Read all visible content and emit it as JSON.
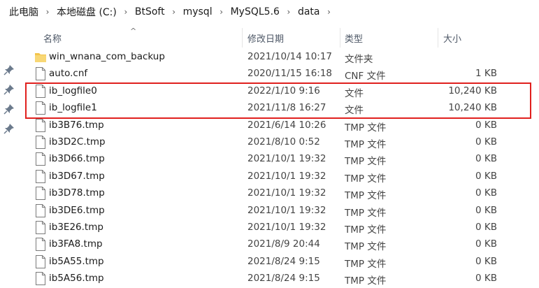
{
  "breadcrumb": {
    "items": [
      "此电脑",
      "本地磁盘 (C:)",
      "BtSoft",
      "mysql",
      "MySQL5.6",
      "data"
    ]
  },
  "columns": {
    "name": "名称",
    "modified": "修改日期",
    "type": "类型",
    "size": "大小"
  },
  "files": [
    {
      "name": "win_wnana_com_backup",
      "modified": "2021/10/14 10:17",
      "type": "文件夹",
      "size": "",
      "icon": "folder-icon"
    },
    {
      "name": "auto.cnf",
      "modified": "2020/11/15 16:18",
      "type": "CNF 文件",
      "size": "1 KB",
      "icon": "file-icon"
    },
    {
      "name": "ib_logfile0",
      "modified": "2022/1/10 9:16",
      "type": "文件",
      "size": "10,240 KB",
      "icon": "file-icon"
    },
    {
      "name": "ib_logfile1",
      "modified": "2021/11/8 16:27",
      "type": "文件",
      "size": "10,240 KB",
      "icon": "file-icon"
    },
    {
      "name": "ib3B76.tmp",
      "modified": "2021/6/14 10:26",
      "type": "TMP 文件",
      "size": "0 KB",
      "icon": "file-icon"
    },
    {
      "name": "ib3D2C.tmp",
      "modified": "2021/8/10 0:52",
      "type": "TMP 文件",
      "size": "0 KB",
      "icon": "file-icon"
    },
    {
      "name": "ib3D66.tmp",
      "modified": "2021/10/1 19:32",
      "type": "TMP 文件",
      "size": "0 KB",
      "icon": "file-icon"
    },
    {
      "name": "ib3D67.tmp",
      "modified": "2021/10/1 19:32",
      "type": "TMP 文件",
      "size": "0 KB",
      "icon": "file-icon"
    },
    {
      "name": "ib3D78.tmp",
      "modified": "2021/10/1 19:32",
      "type": "TMP 文件",
      "size": "0 KB",
      "icon": "file-icon"
    },
    {
      "name": "ib3DE6.tmp",
      "modified": "2021/10/1 19:32",
      "type": "TMP 文件",
      "size": "0 KB",
      "icon": "file-icon"
    },
    {
      "name": "ib3E26.tmp",
      "modified": "2021/10/1 19:32",
      "type": "TMP 文件",
      "size": "0 KB",
      "icon": "file-icon"
    },
    {
      "name": "ib3FA8.tmp",
      "modified": "2021/8/9 20:44",
      "type": "TMP 文件",
      "size": "0 KB",
      "icon": "file-icon"
    },
    {
      "name": "ib5A55.tmp",
      "modified": "2021/8/24 9:15",
      "type": "TMP 文件",
      "size": "0 KB",
      "icon": "file-icon"
    },
    {
      "name": "ib5A56.tmp",
      "modified": "2021/8/24 9:15",
      "type": "TMP 文件",
      "size": "0 KB",
      "icon": "file-icon"
    }
  ],
  "colors": {
    "highlight": "#e0201e",
    "folder": "#f3c44b",
    "header_text": "#4d5766"
  }
}
